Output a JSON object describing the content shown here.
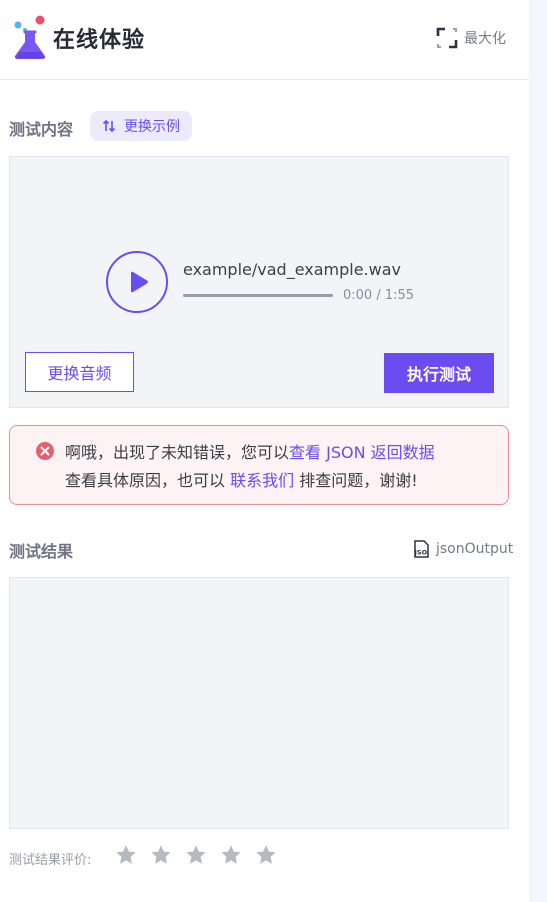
{
  "header": {
    "title": "在线体验",
    "maximize_label": "最大化",
    "logo_icon": "flask-logo-icon",
    "maximize_icon": "maximize-icon"
  },
  "test_content": {
    "title": "测试内容",
    "swap_example_label": "更换示例",
    "swap_icon": "swap-icon"
  },
  "audio": {
    "file_name": "example/vad_example.wav",
    "time": "0:00 / 1:55",
    "progress": 0,
    "play_icon": "play-icon"
  },
  "actions": {
    "change_audio_label": "更换音频",
    "run_test_label": "执行测试"
  },
  "error": {
    "icon": "error-circle-icon",
    "line1_prefix": "啊哦，出现了未知错误，您可以",
    "line1_link": "查看 JSON 返回数据",
    "line2_prefix": "查看具体原因，也可以 ",
    "line2_link": "联系我们",
    "line2_suffix": " 排查问题，谢谢!"
  },
  "result": {
    "title": "测试结果",
    "json_output_label": "jsonOutput",
    "json_icon": "json-file-icon"
  },
  "rating": {
    "label": "测试结果评价:",
    "max": 5,
    "value": 0
  },
  "colors": {
    "accent": "#6b4cf0",
    "error_border": "#e98d97",
    "error_icon": "#e5606e",
    "star_empty": "#b8b9c0"
  }
}
